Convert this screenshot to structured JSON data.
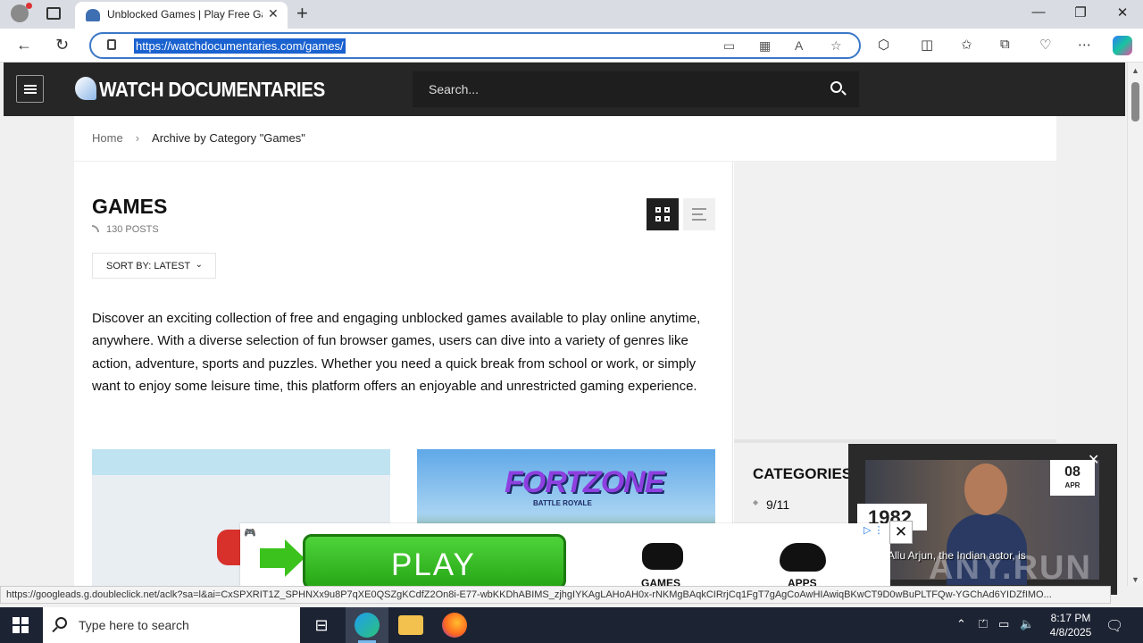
{
  "browser": {
    "tab_title": "Unblocked Games | Play Free Games",
    "url": "https://watchdocumentaries.com/games/",
    "status_url": "https://googleads.g.doubleclick.net/aclk?sa=l&ai=CxSPXRIT1Z_SPHNXx9u8P7qXE0QSZgKCdfZ2On8i-E77-wbKKDhABIMS_zjhgIYKAgLAHoAH0x-rNKMgBAqkCIRrjCq1FgT7gAgCoAwHIAwiqBKwCT9D0wBuPLTFQw-YGChAd6YIDZfIMO...",
    "win_minimize": "—",
    "win_restore": "❐",
    "win_close": "✕"
  },
  "site": {
    "logo": "WATCH DOCUMENTARIES",
    "search_placeholder": "Search..."
  },
  "breadcrumb": {
    "home": "Home",
    "separator": "›",
    "current": "Archive by Category \"Games\""
  },
  "main": {
    "title": "GAMES",
    "post_count": "130 POSTS",
    "sort_label": "SORT BY: LATEST",
    "description": "Discover an exciting collection of free and engaging unblocked games available to play online anytime, anywhere. With a diverse selection of fun browser games, users can dive into a variety of genres like action, adventure, sports and puzzles. Whether you need a quick break from school or work, or simply want to enjoy some leisure time, this platform offers an enjoyable and unrestricted gaming experience.",
    "thumb2_title": "FORTZONE",
    "thumb2_subtitle": "BATTLE ROYALE"
  },
  "sidebar": {
    "categories_title": "CATEGORIES",
    "categories": [
      "9/11"
    ]
  },
  "video_ad": {
    "day": "08",
    "month": "APR",
    "year": "1982",
    "caption": "Allu Arjun, the Indian actor, is",
    "watermark": "ANY.RUN"
  },
  "banner_ad": {
    "play_label": "PLAY",
    "games_label": "GAMES",
    "apps_label": "APPS"
  },
  "taskbar": {
    "search_placeholder": "Type here to search",
    "time": "8:17 PM",
    "date": "4/8/2025"
  }
}
